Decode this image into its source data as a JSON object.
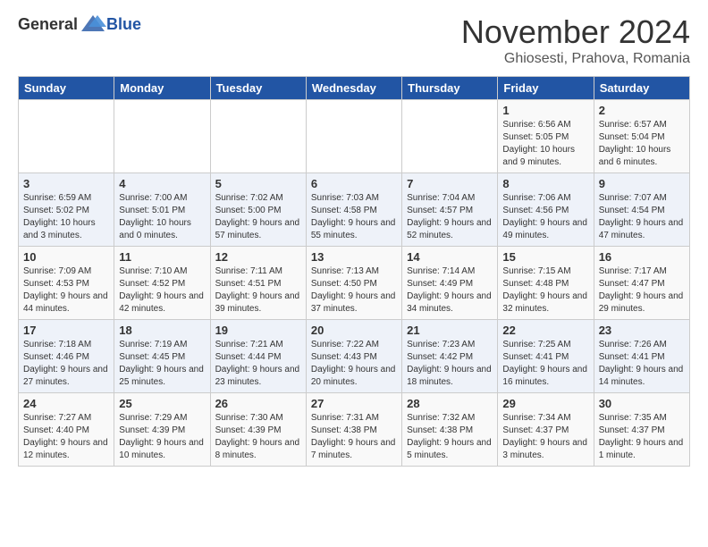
{
  "logo": {
    "general": "General",
    "blue": "Blue"
  },
  "header": {
    "month": "November 2024",
    "location": "Ghiosesti, Prahova, Romania"
  },
  "weekdays": [
    "Sunday",
    "Monday",
    "Tuesday",
    "Wednesday",
    "Thursday",
    "Friday",
    "Saturday"
  ],
  "weeks": [
    [
      {
        "day": "",
        "info": ""
      },
      {
        "day": "",
        "info": ""
      },
      {
        "day": "",
        "info": ""
      },
      {
        "day": "",
        "info": ""
      },
      {
        "day": "",
        "info": ""
      },
      {
        "day": "1",
        "info": "Sunrise: 6:56 AM\nSunset: 5:05 PM\nDaylight: 10 hours and 9 minutes."
      },
      {
        "day": "2",
        "info": "Sunrise: 6:57 AM\nSunset: 5:04 PM\nDaylight: 10 hours and 6 minutes."
      }
    ],
    [
      {
        "day": "3",
        "info": "Sunrise: 6:59 AM\nSunset: 5:02 PM\nDaylight: 10 hours and 3 minutes."
      },
      {
        "day": "4",
        "info": "Sunrise: 7:00 AM\nSunset: 5:01 PM\nDaylight: 10 hours and 0 minutes."
      },
      {
        "day": "5",
        "info": "Sunrise: 7:02 AM\nSunset: 5:00 PM\nDaylight: 9 hours and 57 minutes."
      },
      {
        "day": "6",
        "info": "Sunrise: 7:03 AM\nSunset: 4:58 PM\nDaylight: 9 hours and 55 minutes."
      },
      {
        "day": "7",
        "info": "Sunrise: 7:04 AM\nSunset: 4:57 PM\nDaylight: 9 hours and 52 minutes."
      },
      {
        "day": "8",
        "info": "Sunrise: 7:06 AM\nSunset: 4:56 PM\nDaylight: 9 hours and 49 minutes."
      },
      {
        "day": "9",
        "info": "Sunrise: 7:07 AM\nSunset: 4:54 PM\nDaylight: 9 hours and 47 minutes."
      }
    ],
    [
      {
        "day": "10",
        "info": "Sunrise: 7:09 AM\nSunset: 4:53 PM\nDaylight: 9 hours and 44 minutes."
      },
      {
        "day": "11",
        "info": "Sunrise: 7:10 AM\nSunset: 4:52 PM\nDaylight: 9 hours and 42 minutes."
      },
      {
        "day": "12",
        "info": "Sunrise: 7:11 AM\nSunset: 4:51 PM\nDaylight: 9 hours and 39 minutes."
      },
      {
        "day": "13",
        "info": "Sunrise: 7:13 AM\nSunset: 4:50 PM\nDaylight: 9 hours and 37 minutes."
      },
      {
        "day": "14",
        "info": "Sunrise: 7:14 AM\nSunset: 4:49 PM\nDaylight: 9 hours and 34 minutes."
      },
      {
        "day": "15",
        "info": "Sunrise: 7:15 AM\nSunset: 4:48 PM\nDaylight: 9 hours and 32 minutes."
      },
      {
        "day": "16",
        "info": "Sunrise: 7:17 AM\nSunset: 4:47 PM\nDaylight: 9 hours and 29 minutes."
      }
    ],
    [
      {
        "day": "17",
        "info": "Sunrise: 7:18 AM\nSunset: 4:46 PM\nDaylight: 9 hours and 27 minutes."
      },
      {
        "day": "18",
        "info": "Sunrise: 7:19 AM\nSunset: 4:45 PM\nDaylight: 9 hours and 25 minutes."
      },
      {
        "day": "19",
        "info": "Sunrise: 7:21 AM\nSunset: 4:44 PM\nDaylight: 9 hours and 23 minutes."
      },
      {
        "day": "20",
        "info": "Sunrise: 7:22 AM\nSunset: 4:43 PM\nDaylight: 9 hours and 20 minutes."
      },
      {
        "day": "21",
        "info": "Sunrise: 7:23 AM\nSunset: 4:42 PM\nDaylight: 9 hours and 18 minutes."
      },
      {
        "day": "22",
        "info": "Sunrise: 7:25 AM\nSunset: 4:41 PM\nDaylight: 9 hours and 16 minutes."
      },
      {
        "day": "23",
        "info": "Sunrise: 7:26 AM\nSunset: 4:41 PM\nDaylight: 9 hours and 14 minutes."
      }
    ],
    [
      {
        "day": "24",
        "info": "Sunrise: 7:27 AM\nSunset: 4:40 PM\nDaylight: 9 hours and 12 minutes."
      },
      {
        "day": "25",
        "info": "Sunrise: 7:29 AM\nSunset: 4:39 PM\nDaylight: 9 hours and 10 minutes."
      },
      {
        "day": "26",
        "info": "Sunrise: 7:30 AM\nSunset: 4:39 PM\nDaylight: 9 hours and 8 minutes."
      },
      {
        "day": "27",
        "info": "Sunrise: 7:31 AM\nSunset: 4:38 PM\nDaylight: 9 hours and 7 minutes."
      },
      {
        "day": "28",
        "info": "Sunrise: 7:32 AM\nSunset: 4:38 PM\nDaylight: 9 hours and 5 minutes."
      },
      {
        "day": "29",
        "info": "Sunrise: 7:34 AM\nSunset: 4:37 PM\nDaylight: 9 hours and 3 minutes."
      },
      {
        "day": "30",
        "info": "Sunrise: 7:35 AM\nSunset: 4:37 PM\nDaylight: 9 hours and 1 minute."
      }
    ]
  ]
}
